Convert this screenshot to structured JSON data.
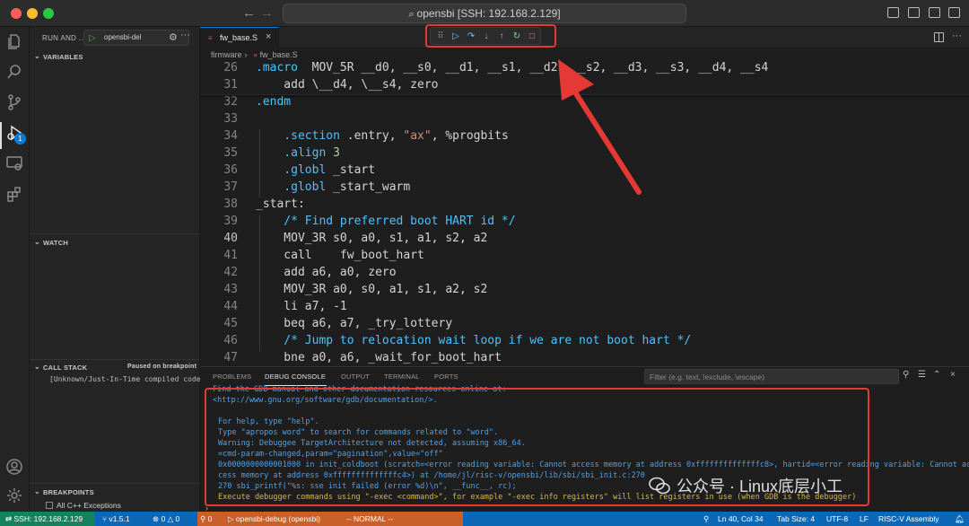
{
  "window": {
    "title": "opensbi [SSH: 192.168.2.129]",
    "traffic_colors": [
      "#ff5f57",
      "#febc2e",
      "#28c840"
    ]
  },
  "sidebar": {
    "header": "RUN AND ...",
    "launch_config": "opensbi-del",
    "sections": {
      "variables": "VARIABLES",
      "watch": "WATCH",
      "call_stack": "CALL STACK",
      "call_stack_status": "Paused on breakpoint",
      "call_stack_frame": "[Unknown/Just-In-Time compiled code]",
      "breakpoints": "BREAKPOINTS",
      "breakpoint_item": "All C++ Exceptions"
    },
    "debug_badge": "1"
  },
  "editor": {
    "tab_label": "fw_base.S",
    "tab_icon": "asm-file-icon",
    "breadcrumb": [
      "firmware",
      "fw_base.S"
    ],
    "sticky_lines": [
      {
        "ln": "26",
        "parts": [
          {
            "t": ".macro",
            "c": "#4fc1ff"
          },
          {
            "t": "  MOV_5R __d0, __s0, __d1, __s1, __d2, __s2, __d3, __s3, __d4, __s4",
            "c": "#d4d4d4"
          }
        ]
      },
      {
        "ln": "31",
        "parts": [
          {
            "t": "    add \\__d4, \\__s4, zero",
            "c": "#d4d4d4"
          }
        ]
      }
    ],
    "lines": [
      {
        "ln": "32",
        "parts": [
          {
            "t": ".endm",
            "c": "#4fc1ff"
          }
        ]
      },
      {
        "ln": "33",
        "parts": []
      },
      {
        "ln": "34",
        "parts": [
          {
            "t": "    .section",
            "c": "#4fc1ff"
          },
          {
            "t": " .entry, ",
            "c": "#d4d4d4"
          },
          {
            "t": "\"ax\"",
            "c": "#ce9178"
          },
          {
            "t": ", %progbits",
            "c": "#d4d4d4"
          }
        ]
      },
      {
        "ln": "35",
        "parts": [
          {
            "t": "    .align",
            "c": "#4fc1ff"
          },
          {
            "t": " 3",
            "c": "#b5cea8"
          }
        ]
      },
      {
        "ln": "36",
        "parts": [
          {
            "t": "    .globl",
            "c": "#4fc1ff"
          },
          {
            "t": " _start",
            "c": "#d4d4d4"
          }
        ]
      },
      {
        "ln": "37",
        "parts": [
          {
            "t": "    .globl",
            "c": "#4fc1ff"
          },
          {
            "t": " _start_warm",
            "c": "#d4d4d4"
          }
        ]
      },
      {
        "ln": "38",
        "parts": [
          {
            "t": "_start:",
            "c": "#d4d4d4"
          }
        ]
      },
      {
        "ln": "39",
        "parts": [
          {
            "t": "    /* Find preferred boot HART id */",
            "c": "#4fc1ff"
          }
        ]
      },
      {
        "ln": "40",
        "current": true,
        "parts": [
          {
            "t": "    MOV_3R",
            "c": "#d4d4d4"
          },
          {
            "t": " s0, a0, s1, a1, s2, a2",
            "c": "#d4d4d4"
          }
        ]
      },
      {
        "ln": "41",
        "parts": [
          {
            "t": "    call",
            "c": "#d4d4d4"
          },
          {
            "t": "    fw_boot_hart",
            "c": "#d4d4d4"
          }
        ]
      },
      {
        "ln": "42",
        "parts": [
          {
            "t": "    add",
            "c": "#d4d4d4"
          },
          {
            "t": " a6, a0, zero",
            "c": "#d4d4d4"
          }
        ]
      },
      {
        "ln": "43",
        "parts": [
          {
            "t": "    MOV_3R",
            "c": "#d4d4d4"
          },
          {
            "t": " a0, s0, a1, s1, a2, s2",
            "c": "#d4d4d4"
          }
        ]
      },
      {
        "ln": "44",
        "parts": [
          {
            "t": "    li",
            "c": "#d4d4d4"
          },
          {
            "t": " a7, -1",
            "c": "#d4d4d4"
          }
        ]
      },
      {
        "ln": "45",
        "parts": [
          {
            "t": "    beq",
            "c": "#d4d4d4"
          },
          {
            "t": " a6, a7, _try_lottery",
            "c": "#d4d4d4"
          }
        ]
      },
      {
        "ln": "46",
        "parts": [
          {
            "t": "    /* Jump to relocation wait loop if we are not boot hart */",
            "c": "#4fc1ff"
          }
        ]
      },
      {
        "ln": "47",
        "parts": [
          {
            "t": "    bne",
            "c": "#d4d4d4"
          },
          {
            "t": " a0, a6, _wait_for_boot_hart",
            "c": "#d4d4d4"
          }
        ]
      }
    ],
    "debug_controls": [
      {
        "name": "drag-handle-icon",
        "glyph": "⠿",
        "color": "#8a8a8a"
      },
      {
        "name": "continue-icon",
        "glyph": "▷",
        "color": "#75beff"
      },
      {
        "name": "step-over-icon",
        "glyph": "↷",
        "color": "#75beff"
      },
      {
        "name": "step-into-icon",
        "glyph": "↓",
        "color": "#75beff"
      },
      {
        "name": "step-out-icon",
        "glyph": "↑",
        "color": "#75beff"
      },
      {
        "name": "restart-icon",
        "glyph": "↻",
        "color": "#89d185"
      },
      {
        "name": "stop-icon",
        "glyph": "□",
        "color": "#f48771"
      }
    ]
  },
  "panel": {
    "tabs": [
      "PROBLEMS",
      "DEBUG CONSOLE",
      "OUTPUT",
      "TERMINAL",
      "PORTS"
    ],
    "active_tab": "DEBUG CONSOLE",
    "filter_placeholder": "Filter (e.g. text, !exclude, \\escape)",
    "console_lines": [
      {
        "t": "Find the GDB manual and other documentation resources online at:",
        "c": "blue"
      },
      {
        "t": "    <http://www.gnu.org/software/gdb/documentation/>.",
        "c": "blue"
      },
      {
        "t": "",
        "c": "blue"
      },
      {
        "t": "For help, type \"help\".",
        "c": "blue"
      },
      {
        "t": "Type \"apropos word\" to search for commands related to \"word\".",
        "c": "blue"
      },
      {
        "t": "Warning: Debuggee TargetArchitecture not detected, assuming x86_64.",
        "c": "blue"
      },
      {
        "t": "=cmd-param-changed,param=\"pagination\",value=\"off\"",
        "c": "blue"
      },
      {
        "t": "0x0000000000001000 in init_coldboot (scratch=<error reading variable: Cannot access memory at address 0xffffffffffffffc8>, hartid=<error reading variable: Cannot ac",
        "c": "blue"
      },
      {
        "t": "cess memory at address 0xffffffffffffffc4>) at /home/jl/risc-v/opensbi/lib/sbi/sbi_init.c:270",
        "c": "blue"
      },
      {
        "t": "270                     sbi_printf(\"%s: sse init failed (error %d)\\n\", __func__, rc);",
        "c": "blue"
      },
      {
        "t": "Execute debugger commands using \"-exec <command>\", for example \"-exec info registers\" will list registers in use (when GDB is the debugger)",
        "c": "yellow"
      }
    ],
    "prompt": "›"
  },
  "watermark": "公众号 · Linux底层小工",
  "statusbar": {
    "remote": "SSH: 192.168.2.129",
    "branch": "v1.5.1",
    "errors": "0",
    "warnings": "0",
    "ports": "0",
    "debug_config": "opensbi-debug (opensbi)",
    "mode": "-- NORMAL --",
    "position": "Ln 40, Col 34",
    "tab_size": "Tab Size: 4",
    "encoding": "UTF-8",
    "eol": "LF",
    "language": "RISC-V Assembly"
  }
}
